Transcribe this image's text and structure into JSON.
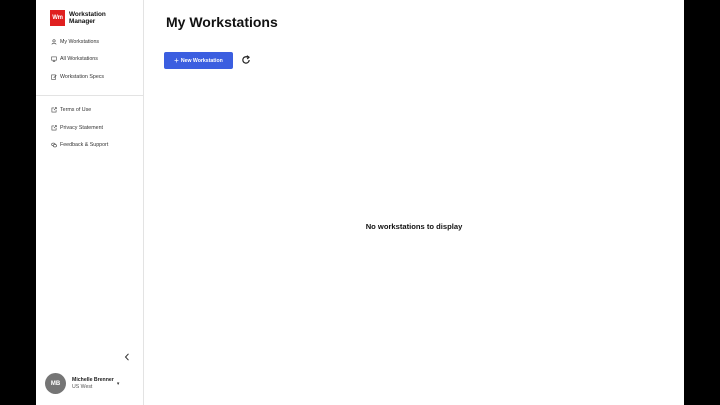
{
  "brand": {
    "logo_text": "Wm",
    "name_line1": "Workstation",
    "name_line2": "Manager",
    "accent": "#e02020"
  },
  "sidebar": {
    "primary": [
      {
        "label": "My Workstations",
        "icon": "user-icon"
      },
      {
        "label": "All Workstations",
        "icon": "monitor-icon"
      },
      {
        "label": "Workstation Specs",
        "icon": "edit-icon"
      }
    ],
    "secondary": [
      {
        "label": "Terms of Use",
        "icon": "external-link-icon"
      },
      {
        "label": "Privacy Statement",
        "icon": "external-link-icon"
      },
      {
        "label": "Feedback & Support",
        "icon": "chat-icon"
      }
    ]
  },
  "user": {
    "initials": "MB",
    "name": "Michelle Brenner",
    "region": "US West"
  },
  "main": {
    "title": "My Workstations",
    "new_button_label": "New Workstation",
    "empty_message": "No workstations to display"
  },
  "colors": {
    "primary_button": "#3b5ee0",
    "avatar": "#757575"
  }
}
